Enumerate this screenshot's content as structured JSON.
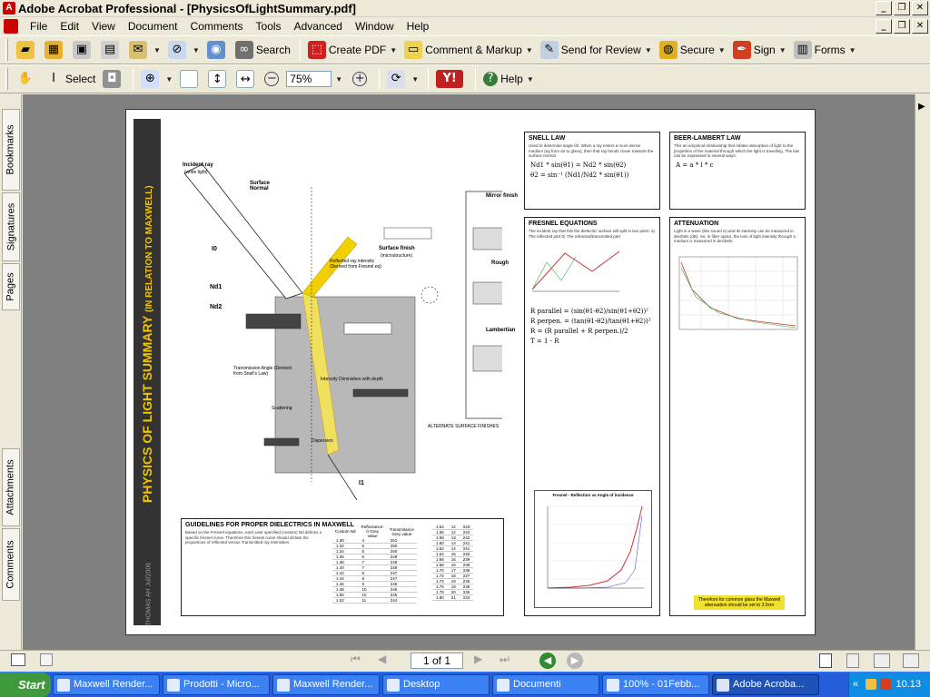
{
  "window": {
    "title": "Adobe Acrobat Professional - [PhysicsOfLightSummary.pdf]",
    "controls": [
      "_",
      "❐",
      "✕"
    ]
  },
  "menu": [
    "File",
    "Edit",
    "View",
    "Document",
    "Comments",
    "Tools",
    "Advanced",
    "Window",
    "Help"
  ],
  "toolbar1": {
    "search": "Search",
    "create_pdf": "Create PDF",
    "comment_markup": "Comment & Markup",
    "send_review": "Send for Review",
    "secure": "Secure",
    "sign": "Sign",
    "forms": "Forms"
  },
  "toolbar2": {
    "select": "Select",
    "zoom_value": "75%",
    "help": "Help"
  },
  "side_tabs": [
    "Bookmarks",
    "Signatures",
    "Pages",
    "Attachments",
    "Comments"
  ],
  "document": {
    "title": "PHYSICS OF LIGHT SUMMARY",
    "subtitle": "(IN RELATION TO MAXWELL)",
    "footer": "THOMAS AH Jul/2006",
    "diagram_labels": {
      "incident": "Incident ray",
      "incident_sub": "(white light)",
      "surface_normal": "Surface Normal",
      "nd1": "Nd1",
      "nd2": "Nd2",
      "i0": "I0",
      "i1": "I1",
      "transmission": "Transmission Angle (Derived from Snell's Law)",
      "scattering": "Scattering",
      "dispersion": "Dispersion",
      "intensity": "Intensity Diminishes with depth",
      "reflected": "Reflected ray intensity (Derived from Fresnel eq)",
      "surface_finish": "Surface finish",
      "surface_finish_sub": "(microstructure)",
      "mirror": "Mirror finish",
      "rough": "Rough",
      "lambertian": "Lambertian",
      "alt": "ALTERNATE SURFACE FINISHES"
    },
    "boxes": {
      "snell": "SNELL LAW",
      "snell_text": "Used to determine angle θ2. When a ray enters a more dense medium (eg from air to glass), then that ray bends closer towards the surface normal",
      "snell_eq1": "Nd1 * sin(θ1) = Nd2 * sin(θ2)",
      "snell_eq2": "θ2 = sin⁻¹ (Nd1/Nd2 * sin(θ1))",
      "beer": "BEER-LAMBERT LAW",
      "beer_text": "This an empirical relationship that relates absorption of light to the properties of the material through which the light is travelling. The law can be expressed in several ways:",
      "beer_eq": "A = a * l * c",
      "fresnel": "FRESNEL EQUATIONS",
      "fresnel_text": "The incident ray that hits the dielectric surface will split in two parts: a) The reflected part b) The refracted/transmitted part",
      "fresnel_eq1": "R parallel = (sin(θ1-θ2)/sin(θ1+θ2))²",
      "fresnel_eq2": "R perpen. = (tan(θ1-θ2)/tan(θ1+θ2))²",
      "fresnel_eq3": "R = (R parallel + R perpen.)/2",
      "fresnel_eq4": "T = 1 - R",
      "fresnel_plot": "Fresnel - Reflection vs Angle of incidence",
      "atten": "ATTENUATION",
      "atten_text": "Light is a wave (like sound is) and its intensity can be measured in decibels (dB). So, in fiber optics, the loss of light intensity through a medium is measured in decibels.",
      "atten_note": "Therefore for common glass the Maxwell attenuation should be set to 3.0cm",
      "guidelines": "GUIDELINES FOR PROPER DIELECTRICS IN MAXWELL",
      "guidelines_text": "Based on the Fresnel equations, each user specified (custom) Nd defines a specific fresnel curve. Therefore this fresnel curve should dictate the proportions of reflected versus Transmitted ray intensities.",
      "col1": "Custom Nd",
      "col2": "Reflectance-0 Grey value",
      "col3": "Transmitance Grey value"
    },
    "table_rows": [
      [
        "1.30",
        "4",
        "251"
      ],
      [
        "1.32",
        "5",
        "250"
      ],
      [
        "1.34",
        "5",
        "250"
      ],
      [
        "1.36",
        "6",
        "249"
      ],
      [
        "1.38",
        "7",
        "248"
      ],
      [
        "1.40",
        "7",
        "248"
      ],
      [
        "1.42",
        "8",
        "247"
      ],
      [
        "1.44",
        "8",
        "247"
      ],
      [
        "1.46",
        "9",
        "246"
      ],
      [
        "1.48",
        "10",
        "245"
      ],
      [
        "1.50",
        "10",
        "245"
      ],
      [
        "1.52",
        "11",
        "244"
      ]
    ],
    "table_rows2": [
      [
        "1.54",
        "12",
        "243"
      ],
      [
        "1.56",
        "12",
        "243"
      ],
      [
        "1.58",
        "13",
        "242"
      ],
      [
        "1.60",
        "14",
        "241"
      ],
      [
        "1.62",
        "14",
        "241"
      ],
      [
        "1.64",
        "15",
        "240"
      ],
      [
        "1.66",
        "16",
        "239"
      ],
      [
        "1.68",
        "16",
        "239"
      ],
      [
        "1.70",
        "17",
        "238"
      ],
      [
        "1.72",
        "18",
        "237"
      ],
      [
        "1.74",
        "19",
        "236"
      ],
      [
        "1.76",
        "19",
        "236"
      ],
      [
        "1.78",
        "20",
        "235"
      ],
      [
        "1.80",
        "21",
        "234"
      ]
    ]
  },
  "status": {
    "page_text": "1 of 1"
  },
  "taskbar": {
    "start": "Start",
    "tasks": [
      "Maxwell Render...",
      "Prodotti - Micro...",
      "Maxwell Render...",
      "Desktop",
      "Documenti",
      "100% - 01Febb...",
      "Adobe Acroba..."
    ],
    "clock": "10.13",
    "tray_arrow": "«"
  },
  "colors": {
    "accent": "#f0c400",
    "xp_blue": "#245edb",
    "start_green": "#3c9a3c"
  }
}
